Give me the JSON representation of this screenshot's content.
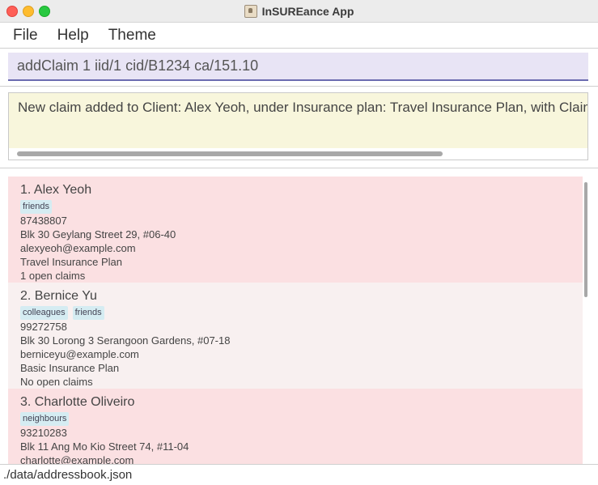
{
  "window": {
    "title": "InSUREance App"
  },
  "menu": {
    "items": [
      "File",
      "Help",
      "Theme"
    ]
  },
  "command_box": {
    "value": "addClaim 1 iid/1 cid/B1234 ca/151.10"
  },
  "result": {
    "text": "New claim added to Client: Alex Yeoh, under Insurance plan: Travel Insurance Plan, with Claim ID: B"
  },
  "persons": [
    {
      "name": "1. Alex Yeoh",
      "tags": [
        "friends"
      ],
      "phone": "87438807",
      "address": "Blk 30 Geylang Street 29, #06-40",
      "email": "alexyeoh@example.com",
      "plan": "Travel Insurance Plan",
      "claims": "1 open claims"
    },
    {
      "name": "2. Bernice Yu",
      "tags": [
        "colleagues",
        "friends"
      ],
      "phone": "99272758",
      "address": "Blk 30 Lorong 3 Serangoon Gardens, #07-18",
      "email": "berniceyu@example.com",
      "plan": "Basic Insurance Plan",
      "claims": "No open claims"
    },
    {
      "name": "3. Charlotte Oliveiro",
      "tags": [
        "neighbours"
      ],
      "phone": "93210283",
      "address": "Blk 11 Ang Mo Kio Street 74, #11-04",
      "email": "charlotte@example.com"
    }
  ],
  "status_bar": {
    "path": "./data/addressbook.json"
  }
}
